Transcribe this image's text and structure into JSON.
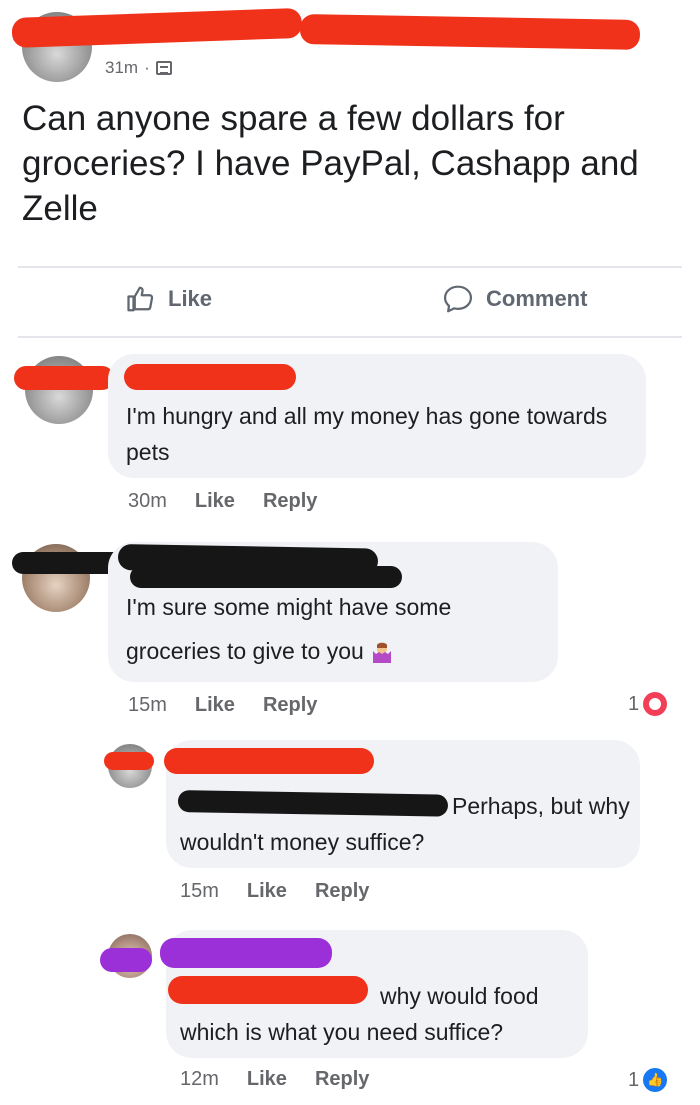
{
  "post": {
    "time": "31m",
    "separator": "·",
    "text": "Can anyone spare a few dollars for groceries? I have PayPal, Cashapp and Zelle",
    "like_label": "Like",
    "comment_label": "Comment"
  },
  "comments": [
    {
      "text": "I'm hungry and all my money has gone towards pets",
      "time": "30m",
      "like": "Like",
      "reply": "Reply"
    },
    {
      "text": "I'm sure some might have some groceries to give to you",
      "time": "15m",
      "like": "Like",
      "reply": "Reply",
      "reaction_count": "1",
      "reaction_type": "heart-icon"
    },
    {
      "text": "Perhaps, but why wouldn't money suffice?",
      "time": "15m",
      "like": "Like",
      "reply": "Reply"
    },
    {
      "text": "why would food which is what you need suffice?",
      "time": "12m",
      "like": "Like",
      "reply": "Reply",
      "reaction_count": "1",
      "reaction_type": "like-icon"
    }
  ],
  "colors": {
    "redaction_red": "#f0321b",
    "redaction_black": "#161616",
    "redaction_purple": "#9b30d9",
    "heart": "#f33e58",
    "like_blue": "#1877f2"
  }
}
